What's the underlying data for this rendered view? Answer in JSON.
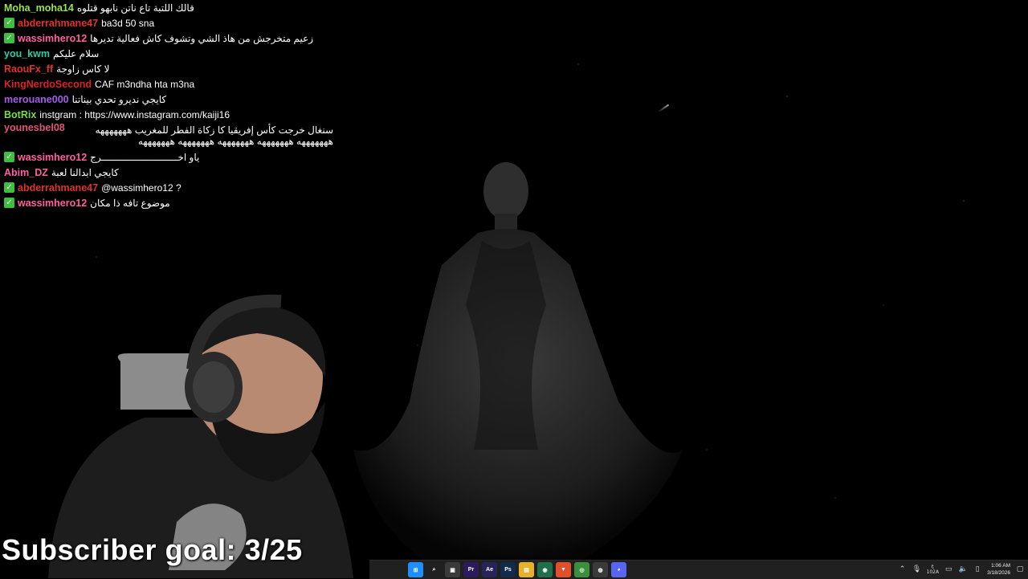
{
  "chat": {
    "messages": [
      {
        "user": "Moha_moha14",
        "color": "#9be34b",
        "badge": false,
        "text": "قالك اللتبة تاع ناتن نابهو قتلوه",
        "rtl": true
      },
      {
        "user": "abderrahmane47",
        "color": "#e0322b",
        "badge": true,
        "text": "ba3d 50 sna",
        "rtl": false
      },
      {
        "user": "wassimhero12",
        "color": "#ff5fa0",
        "badge": true,
        "text": "زعيم متخرجش من هاذ الشي وتشوف كاش فعالية تديرها",
        "rtl": true
      },
      {
        "user": "you_kwm",
        "color": "#2ecca5",
        "badge": false,
        "text": "سلام عليكم",
        "rtl": true
      },
      {
        "user": "RaouFx_ff",
        "color": "#e0322b",
        "badge": false,
        "text": "لا كاس زاوجة",
        "rtl": true
      },
      {
        "user": "KingNerdoSecond",
        "color": "#d9232b",
        "badge": false,
        "text": "CAF m3ndha hta m3na",
        "rtl": false
      },
      {
        "user": "merouane000",
        "color": "#a45ce8",
        "badge": false,
        "text": "كايجي نديرو تحدي بيناتنا",
        "rtl": true
      },
      {
        "user": "BotRix",
        "color": "#7bd94a",
        "badge": false,
        "text": "instgram : https://www.instagram.com/kaiji16",
        "rtl": false
      },
      {
        "user": "younesbel08",
        "color": "#e05577",
        "badge": false,
        "text": "سنغال خرجت كأس إفريقيا كا زكاة الفطر للمغريب هههههههه هههههههه هههههههه هههههههه هههههههه هههههههه",
        "rtl": true,
        "tall": true
      },
      {
        "user": "wassimhero12",
        "color": "#ff5fa0",
        "badge": true,
        "text": "ياو اخـــــــــــــــــــــــــــرج",
        "rtl": true
      },
      {
        "user": "Abim_DZ",
        "color": "#ff5fa0",
        "badge": false,
        "text": "كايجي ابدالنا لعبة",
        "rtl": true
      },
      {
        "user": "abderrahmane47",
        "color": "#e0322b",
        "badge": true,
        "text": "@wassimhero12 ?",
        "rtl": false
      },
      {
        "user": "wassimhero12",
        "color": "#ff5fa0",
        "badge": true,
        "text": "موضوع تافه ذا مكان",
        "rtl": true
      }
    ]
  },
  "overlay": {
    "goal_text": "Subscriber goal: 3/25"
  },
  "taskbar": {
    "apps": [
      {
        "name": "windows-start",
        "color": "#1f8fff",
        "glyph": "⊞"
      },
      {
        "name": "search",
        "color": "#202020",
        "glyph": "⌕"
      },
      {
        "name": "task-view",
        "color": "#3a3a3a",
        "glyph": "▣"
      },
      {
        "name": "premiere",
        "color": "#2b1a5e",
        "glyph": "Pr"
      },
      {
        "name": "after-effects",
        "color": "#26245a",
        "glyph": "Ae"
      },
      {
        "name": "photoshop",
        "color": "#0f2a4a",
        "glyph": "Ps"
      },
      {
        "name": "file-explorer",
        "color": "#e6b22e",
        "glyph": "▤"
      },
      {
        "name": "app-green",
        "color": "#1f6f4a",
        "glyph": "◉"
      },
      {
        "name": "brave",
        "color": "#e2502b",
        "glyph": "▼"
      },
      {
        "name": "chrome",
        "color": "#3a8f3a",
        "glyph": "◎"
      },
      {
        "name": "obs",
        "color": "#3a3a3a",
        "glyph": "◍"
      },
      {
        "name": "discord",
        "color": "#5865f2",
        "glyph": "◕"
      }
    ],
    "tray": {
      "lang_top": "ع",
      "lang_bottom": "102A",
      "time": "1:06 AM",
      "date": "3/18/2026"
    }
  }
}
